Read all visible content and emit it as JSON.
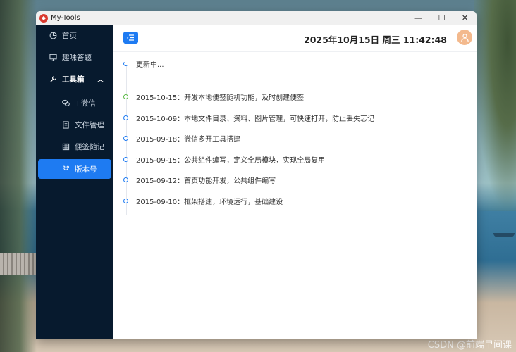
{
  "window": {
    "title": "My-Tools",
    "controls": {
      "minimize": "—",
      "maximize": "☐",
      "close": "✕"
    }
  },
  "sidebar": {
    "items": [
      {
        "label": "首页",
        "icon": "pie-chart-icon"
      },
      {
        "label": "趣味答题",
        "icon": "monitor-icon"
      },
      {
        "label": "工具箱",
        "icon": "wrench-icon",
        "expanded": true
      },
      {
        "label": "+微信",
        "icon": "wechat-icon"
      },
      {
        "label": "文件管理",
        "icon": "document-icon"
      },
      {
        "label": "便签随记",
        "icon": "grid-icon"
      },
      {
        "label": "版本号",
        "icon": "version-icon",
        "active": true
      }
    ]
  },
  "header": {
    "datetime": "2025年10月15日 周三 11:42:48"
  },
  "timeline": {
    "items": [
      {
        "text": "更新中...",
        "status": "loading"
      },
      {
        "text": "2015-10-15：开发本地便签随机功能，及时创建便签",
        "status": "green"
      },
      {
        "text": "2015-10-09：本地文件目录、资料、图片管理，可快速打开，防止丢失忘记",
        "status": "blue"
      },
      {
        "text": "2015-09-18：微信多开工具搭建",
        "status": "blue"
      },
      {
        "text": "2015-09-15：公共组件编写，定义全局模块，实现全局复用",
        "status": "blue"
      },
      {
        "text": "2015-09-12：首页功能开发，公共组件编写",
        "status": "blue"
      },
      {
        "text": "2015-09-10：框架搭建，环境运行，基础建设",
        "status": "blue"
      }
    ]
  },
  "colors": {
    "accent": "#1e7bf2",
    "sidebar_bg": "#071a2e",
    "timeline_green": "#5ab946"
  },
  "watermark": "CSDN @前端早间课"
}
